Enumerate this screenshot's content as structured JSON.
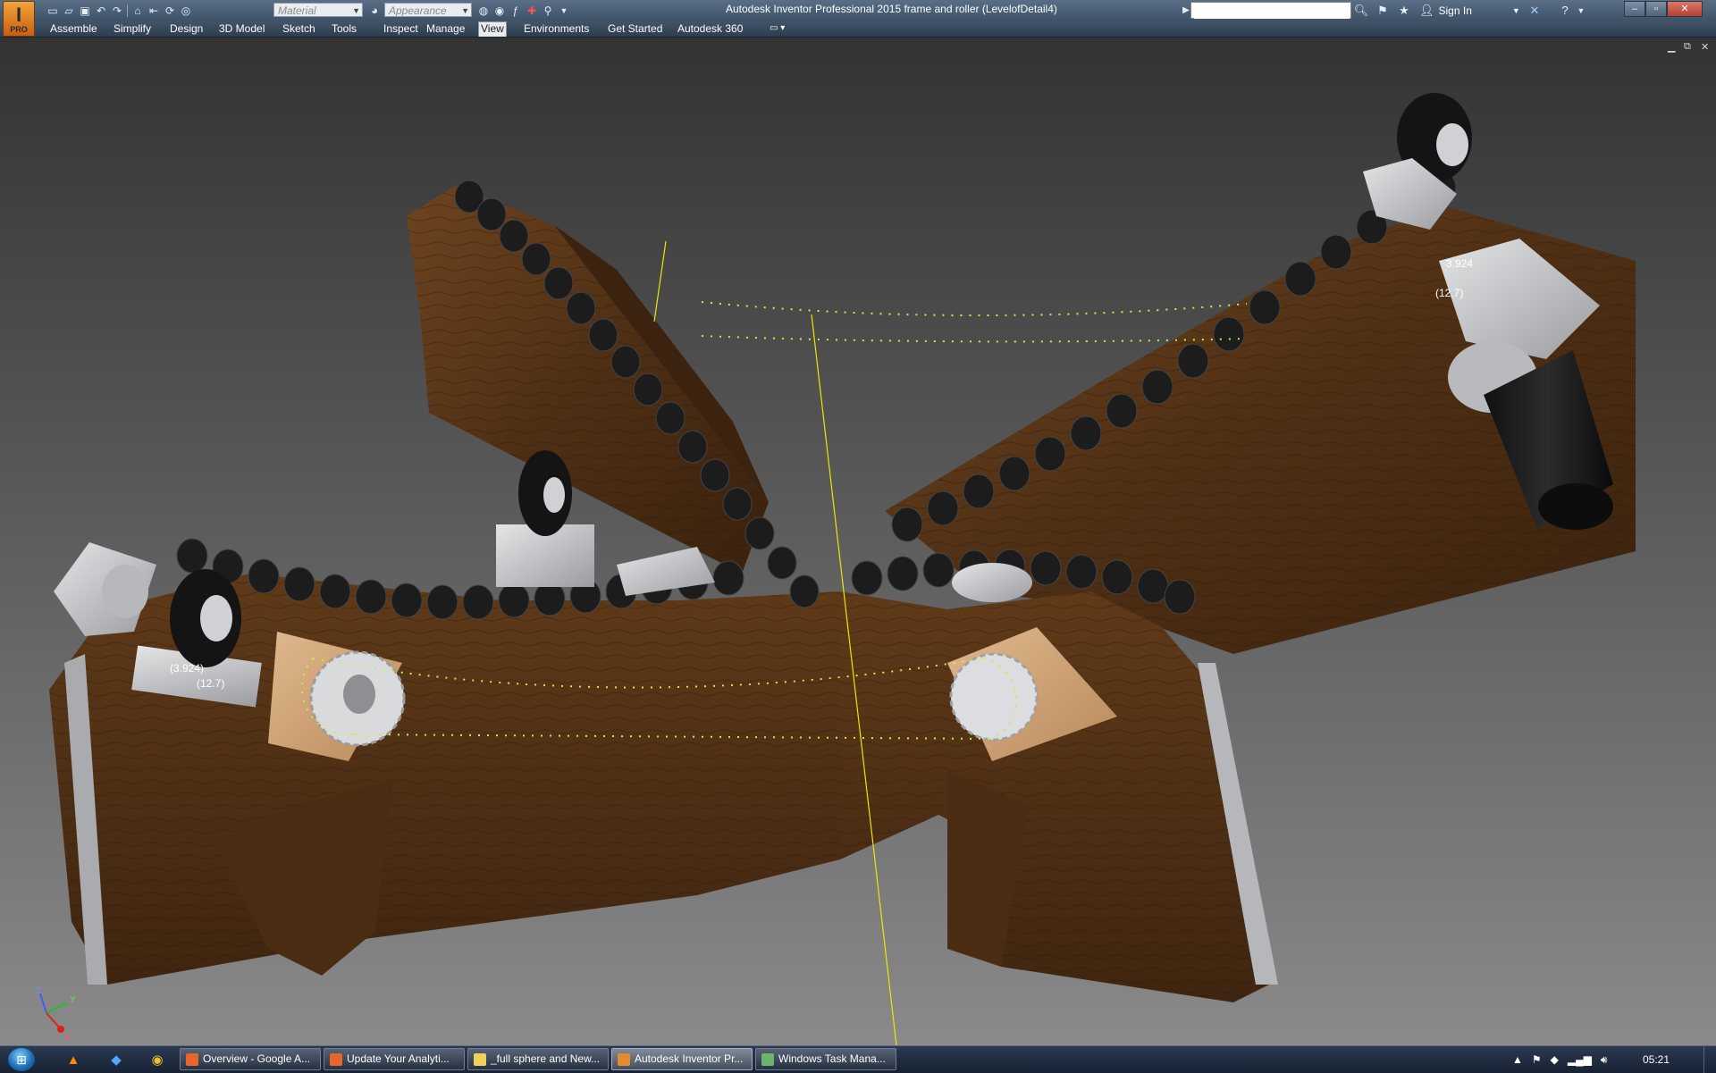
{
  "title_bar": {
    "window_title": "Autodesk Inventor Professional 2015    frame and roller (LevelofDetail4)",
    "material_placeholder": "Material",
    "appearance_placeholder": "Appearance",
    "search_value": "",
    "sign_in_label": "Sign In",
    "app_logo_letter": "I",
    "app_logo_badge": "PRO"
  },
  "ribbon": {
    "tabs": [
      {
        "label": "Assemble"
      },
      {
        "label": "Simplify"
      },
      {
        "label": "Design"
      },
      {
        "label": "3D Model"
      },
      {
        "label": "Sketch"
      },
      {
        "label": "Tools"
      },
      {
        "label": "Inspect"
      },
      {
        "label": "Manage"
      },
      {
        "label": "View",
        "active": true
      },
      {
        "label": "Environments"
      },
      {
        "label": "Get Started"
      },
      {
        "label": "Autodesk 360"
      }
    ]
  },
  "viewport": {
    "dimensions": [
      "(3.924)",
      "(12.7)",
      "3.924",
      "(12.7)"
    ],
    "triad": {
      "x": "X",
      "y": "Y",
      "z": "Z"
    },
    "colors": {
      "wood": "#5a3517",
      "roller": "#1e1e1e",
      "chain": "#c8f03c",
      "aluminum": "#c7c9cc"
    }
  },
  "taskbar": {
    "tasks": [
      {
        "label": "Overview - Google A..."
      },
      {
        "label": "Update Your Analyti..."
      },
      {
        "label": "_full sphere and New..."
      },
      {
        "label": "Autodesk Inventor Pr...",
        "active": true
      },
      {
        "label": "Windows Task Mana..."
      }
    ],
    "clock": "05:21"
  }
}
